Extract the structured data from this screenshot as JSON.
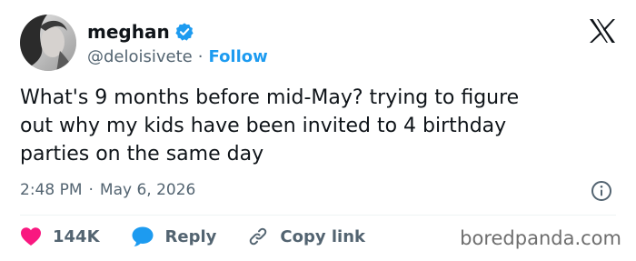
{
  "author": {
    "display_name": "meghan",
    "handle": "@deloisivete",
    "separator": "·",
    "follow_label": "Follow",
    "avatar_icon": "profile-photo-portrait",
    "verified_color": "#1d9bf0"
  },
  "brand": {
    "logo_icon": "x-logo-icon"
  },
  "tweet": {
    "line1": "What's 9 months before mid-May? trying to figure",
    "line2": "out why my kids have been invited to 4 birthday",
    "line3": "parties on the same day"
  },
  "meta": {
    "time": "2:48 PM",
    "separator": "·",
    "date": "May 6, 2026",
    "info_icon": "info-icon"
  },
  "actions": {
    "like_count": "144K",
    "like_color": "#f91880",
    "reply_label": "Reply",
    "reply_color": "#1d9bf0",
    "copy_link_label": "Copy link"
  },
  "watermark": {
    "text": "boredpanda.com"
  }
}
